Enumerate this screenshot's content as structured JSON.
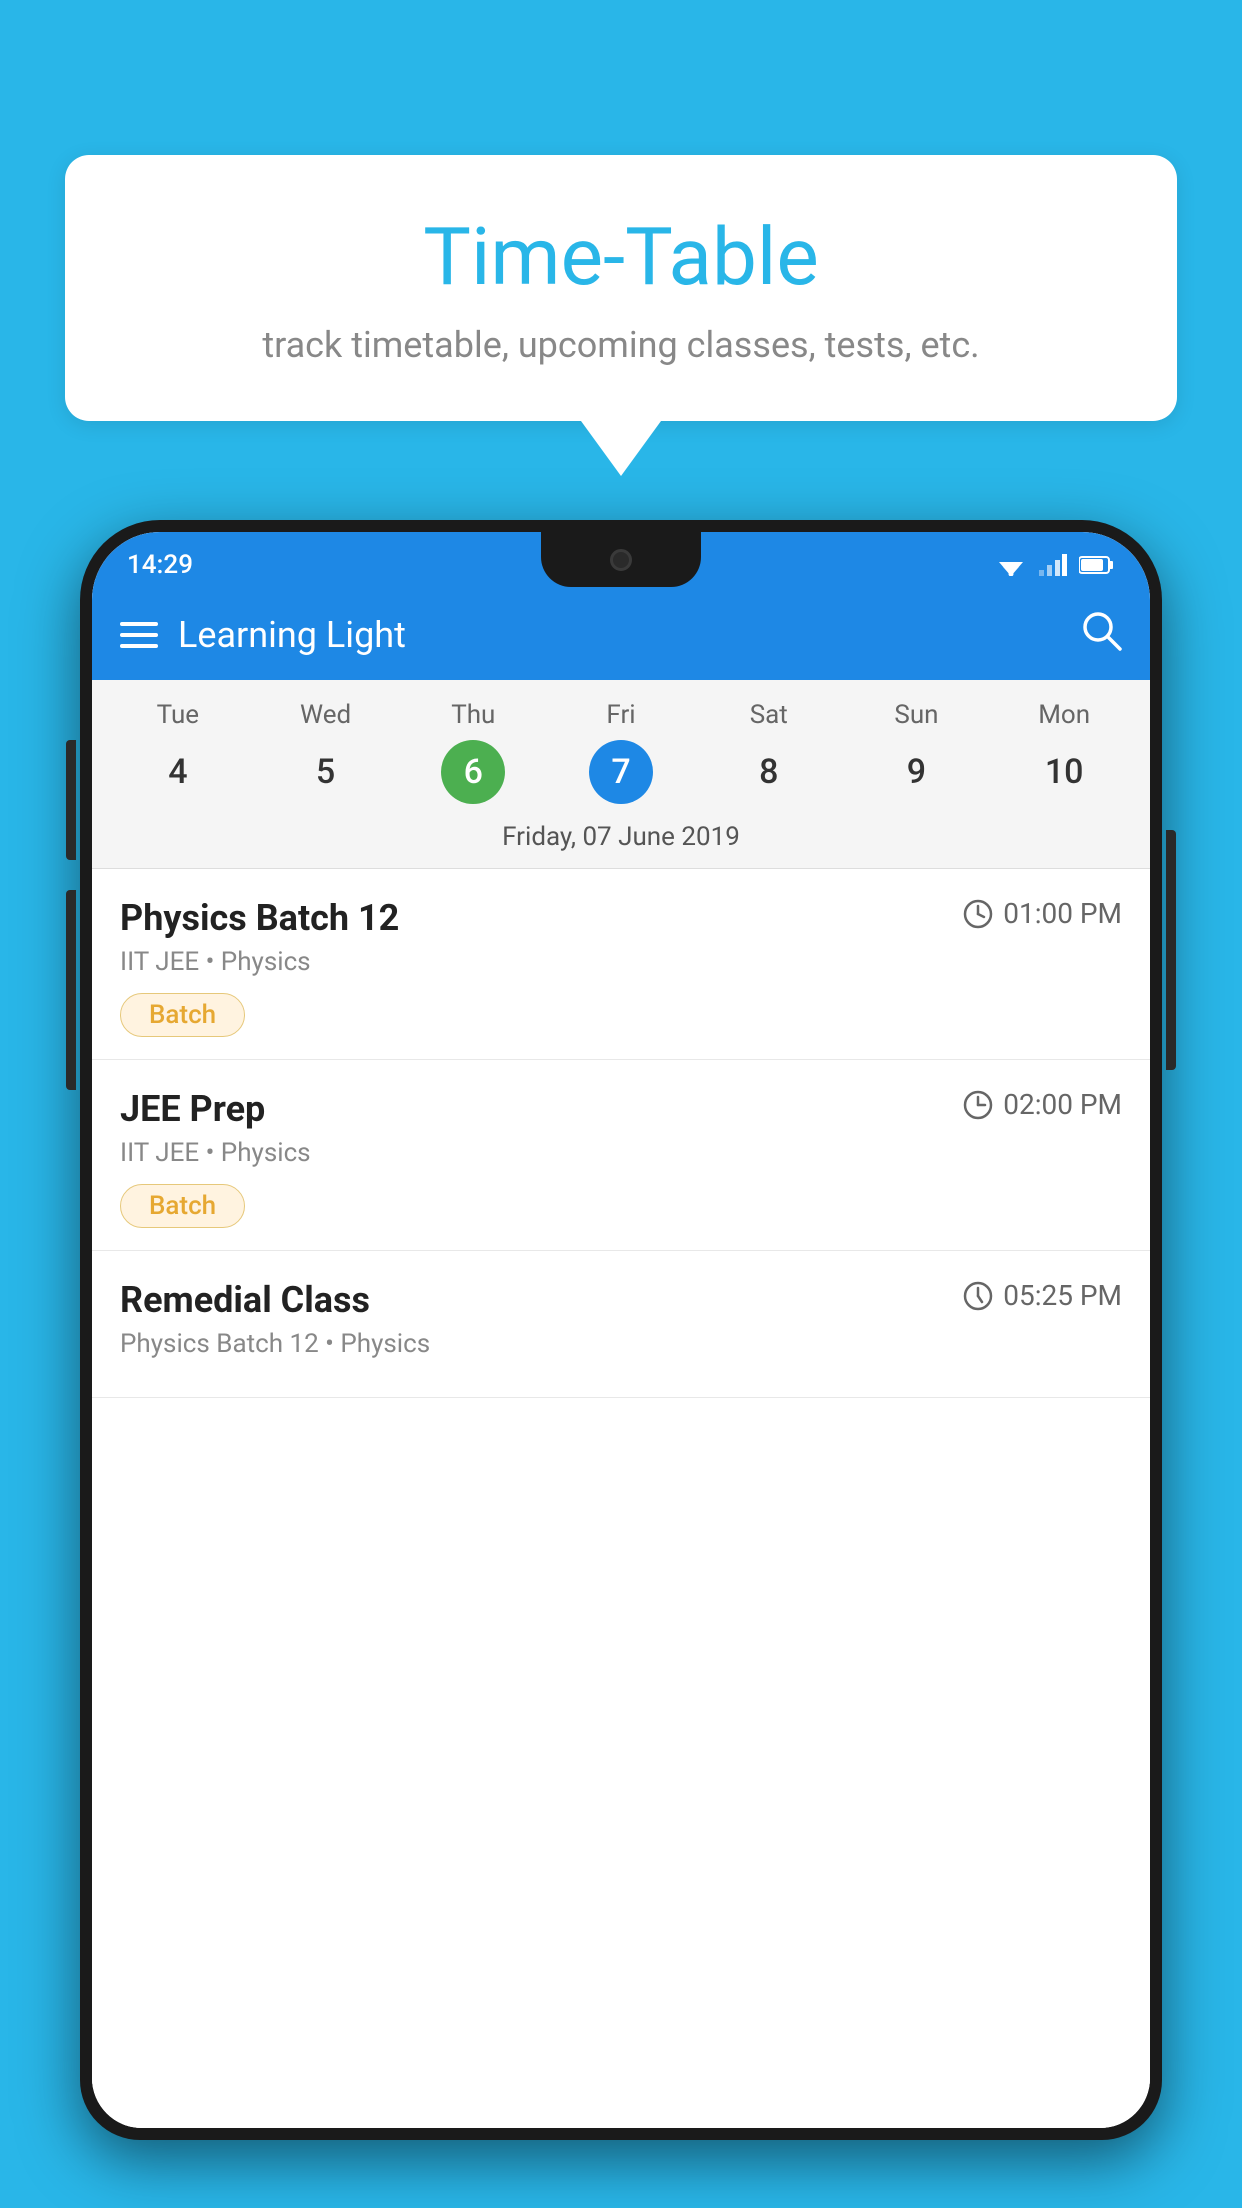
{
  "background_color": "#29b6e8",
  "speech_bubble": {
    "title": "Time-Table",
    "subtitle": "track timetable, upcoming classes, tests, etc."
  },
  "status_bar": {
    "time": "14:29"
  },
  "toolbar": {
    "title": "Learning Light",
    "hamburger_label": "menu",
    "search_label": "search"
  },
  "calendar": {
    "days": [
      {
        "name": "Tue",
        "num": "4",
        "state": "normal"
      },
      {
        "name": "Wed",
        "num": "5",
        "state": "normal"
      },
      {
        "name": "Thu",
        "num": "6",
        "state": "today"
      },
      {
        "name": "Fri",
        "num": "7",
        "state": "selected"
      },
      {
        "name": "Sat",
        "num": "8",
        "state": "normal"
      },
      {
        "name": "Sun",
        "num": "9",
        "state": "normal"
      },
      {
        "name": "Mon",
        "num": "10",
        "state": "normal"
      }
    ],
    "selected_date_label": "Friday, 07 June 2019"
  },
  "schedule_items": [
    {
      "title": "Physics Batch 12",
      "time": "01:00 PM",
      "subtitle": "IIT JEE • Physics",
      "badge": "Batch"
    },
    {
      "title": "JEE Prep",
      "time": "02:00 PM",
      "subtitle": "IIT JEE • Physics",
      "badge": "Batch"
    },
    {
      "title": "Remedial Class",
      "time": "05:25 PM",
      "subtitle": "Physics Batch 12 • Physics",
      "badge": null
    }
  ]
}
